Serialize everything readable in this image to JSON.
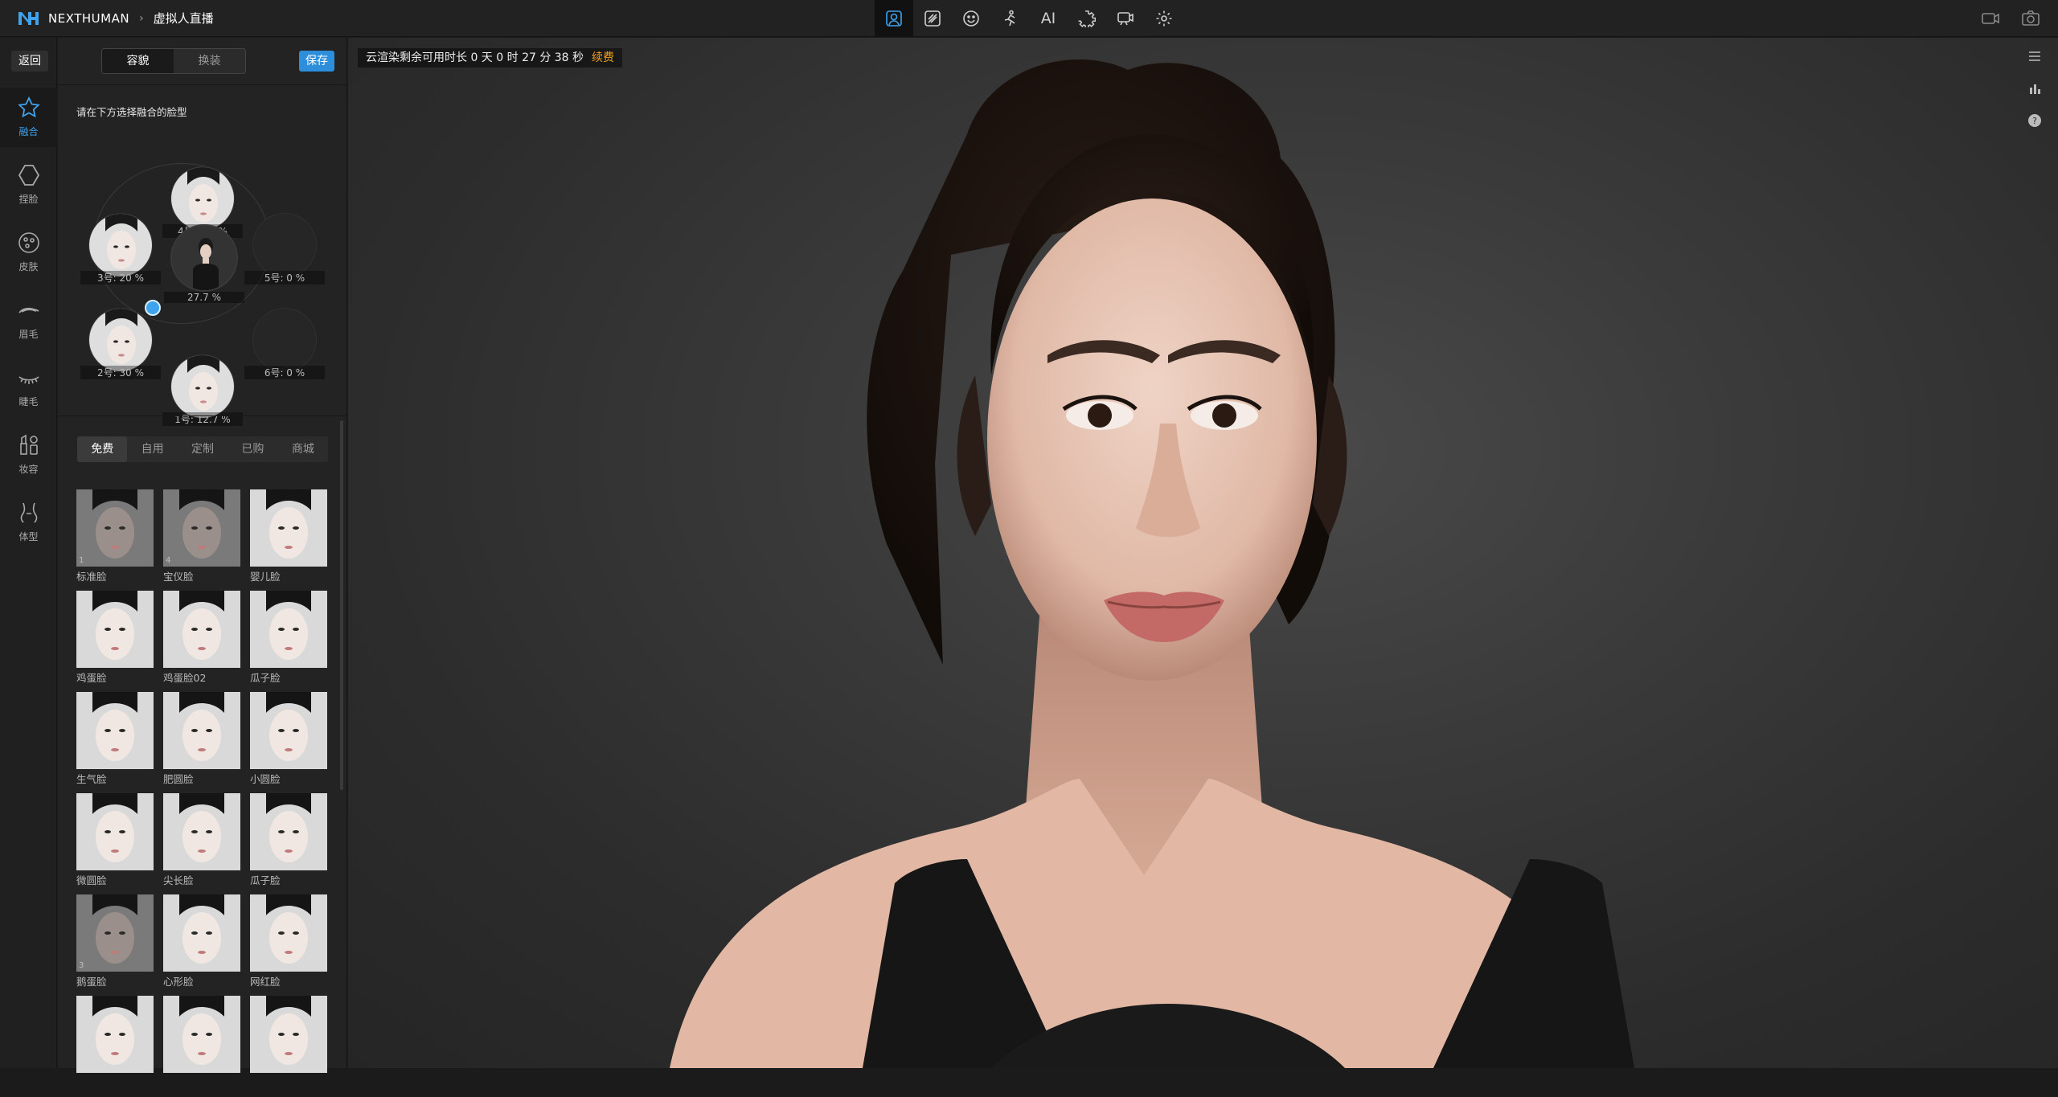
{
  "app": {
    "brand": "NEXTHUMAN",
    "breadcrumb_sep": "›",
    "page": "虚拟人直播"
  },
  "toolbar": {
    "ai_label": "AI",
    "tools": [
      "avatar-icon",
      "edit-brush-icon",
      "face-expression-icon",
      "motion-icon",
      "ai-icon",
      "gear-puzzle-icon",
      "live-stream-icon",
      "settings-icon"
    ],
    "active": "avatar-icon"
  },
  "top_right": [
    "camera-record-icon",
    "screenshot-icon"
  ],
  "sidenav": {
    "back": "返回",
    "items": [
      {
        "label": "融合",
        "icon": "star-icon",
        "active": true
      },
      {
        "label": "捏脸",
        "icon": "hexagon-icon"
      },
      {
        "label": "皮肤",
        "icon": "skin-icon"
      },
      {
        "label": "眉毛",
        "icon": "eyebrow-icon"
      },
      {
        "label": "睫毛",
        "icon": "eyelash-icon"
      },
      {
        "label": "妆容",
        "icon": "makeup-icon"
      },
      {
        "label": "体型",
        "icon": "body-icon"
      }
    ]
  },
  "panel": {
    "seg": [
      "容貌",
      "换装"
    ],
    "save": "保存",
    "blend_title": "请在下方选择融合的脸型",
    "slots": {
      "s4": "4号: 9.6 %",
      "s3": "3号: 20 %",
      "s5": "5号: 0 %",
      "center": "27.7 %",
      "s2": "2号: 30 %",
      "s6": "6号: 0 %",
      "s1": "1号: 12.7 %"
    },
    "tabs": [
      "免费",
      "自用",
      "定制",
      "已购",
      "商城"
    ],
    "presets": [
      {
        "label": "标准脸",
        "num": "1",
        "dark": true
      },
      {
        "label": "宝仪脸",
        "num": "4",
        "dark": true
      },
      {
        "label": "婴儿脸"
      },
      {
        "label": "鸡蛋脸"
      },
      {
        "label": "鸡蛋脸02"
      },
      {
        "label": "瓜子脸"
      },
      {
        "label": "生气脸"
      },
      {
        "label": "肥圆脸"
      },
      {
        "label": "小圆脸"
      },
      {
        "label": "微圆脸"
      },
      {
        "label": "尖长脸"
      },
      {
        "label": "瓜子脸"
      },
      {
        "label": "鹅蛋脸",
        "num": "3",
        "dark": true
      },
      {
        "label": "心形脸"
      },
      {
        "label": "网红脸"
      },
      {
        "label": ""
      },
      {
        "label": ""
      },
      {
        "label": ""
      }
    ]
  },
  "viewport": {
    "render_text": "云渲染剩余可用时长 0 天 0 时 27 分 38 秒",
    "renew": "续费",
    "side_icons": [
      "menu-icon",
      "stats-icon",
      "help-icon"
    ]
  },
  "colors": {
    "accent": "#3fa3ee",
    "renew": "#f0a020",
    "save": "#2d8fdb"
  }
}
